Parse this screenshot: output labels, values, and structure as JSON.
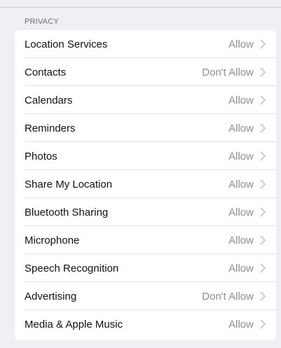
{
  "section": {
    "header": "PRIVACY"
  },
  "rows": [
    {
      "label": "Location Services",
      "value": "Allow"
    },
    {
      "label": "Contacts",
      "value": "Don't Allow"
    },
    {
      "label": "Calendars",
      "value": "Allow"
    },
    {
      "label": "Reminders",
      "value": "Allow"
    },
    {
      "label": "Photos",
      "value": "Allow"
    },
    {
      "label": "Share My Location",
      "value": "Allow"
    },
    {
      "label": "Bluetooth Sharing",
      "value": "Allow"
    },
    {
      "label": "Microphone",
      "value": "Allow"
    },
    {
      "label": "Speech Recognition",
      "value": "Allow"
    },
    {
      "label": "Advertising",
      "value": "Don't Allow"
    },
    {
      "label": "Media & Apple Music",
      "value": "Allow"
    }
  ],
  "icons": {
    "disclosure": "chevron-right-icon"
  },
  "colors": {
    "background": "#efeff4",
    "card": "#ffffff",
    "label_text": "#111111",
    "value_text": "#8e8e93",
    "header_text": "#6d6d72"
  }
}
